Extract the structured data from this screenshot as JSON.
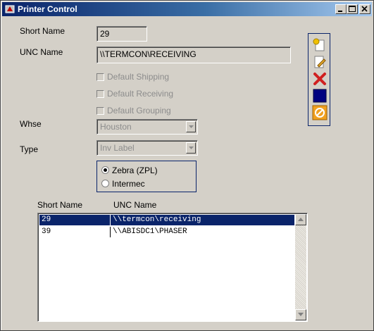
{
  "window": {
    "title": "Printer Control",
    "controls": {
      "minimize": "minimize",
      "maximize": "maximize",
      "close": "close"
    }
  },
  "form": {
    "short_name_label": "Short Name",
    "short_name_value": "29",
    "unc_name_label": "UNC Name",
    "unc_name_value": "\\\\TERMCON\\RECEIVING",
    "checkboxes": {
      "default_shipping": "Default Shipping",
      "default_receiving": "Default Receiving",
      "default_grouping": "Default Grouping"
    },
    "whse_label": "Whse",
    "whse_value": "Houston",
    "type_label": "Type",
    "type_value": "Inv Label",
    "printer_language": {
      "options": [
        "Zebra (ZPL)",
        "Intermec"
      ],
      "selected": "Zebra (ZPL)"
    }
  },
  "toolbar": {
    "icons": [
      "new-icon",
      "edit-icon",
      "delete-icon",
      "save-icon",
      "cancel-icon"
    ]
  },
  "list": {
    "headers": [
      "Short Name",
      "UNC Name"
    ],
    "rows": [
      {
        "short_name": "29",
        "unc_name": "\\\\termcon\\receiving",
        "selected": true
      },
      {
        "short_name": "39",
        "unc_name": "\\\\ABISDC1\\PHASER",
        "selected": false
      }
    ]
  },
  "colors": {
    "titlebar_start": "#0a246a",
    "titlebar_end": "#a6caf0",
    "face": "#d4d0c8",
    "selection": "#0a246a"
  }
}
